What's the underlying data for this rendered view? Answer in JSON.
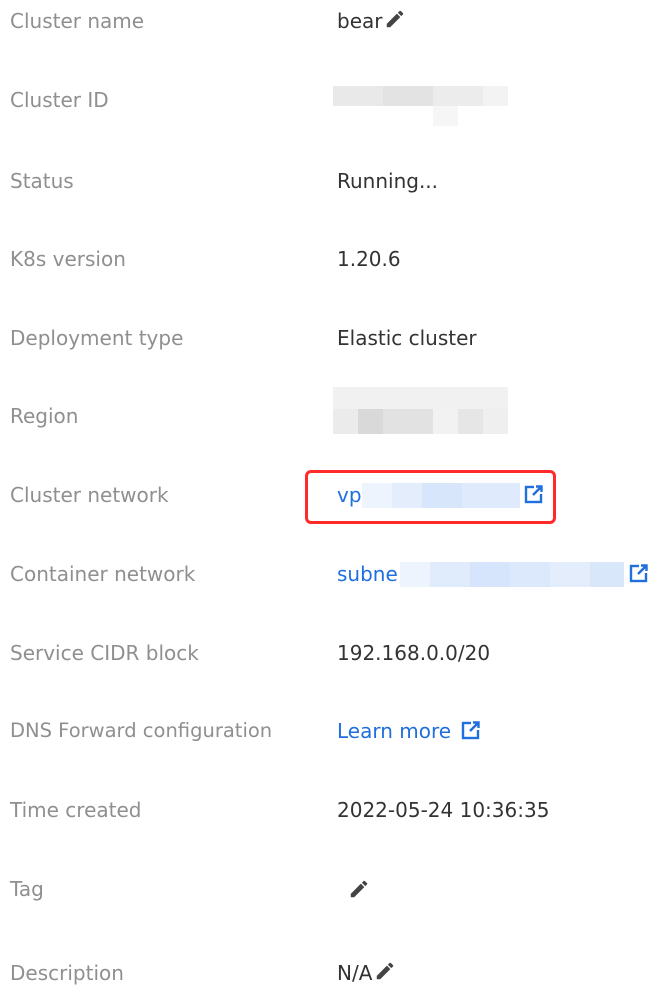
{
  "details": {
    "cluster_name": {
      "label": "Cluster name",
      "value": "bear"
    },
    "cluster_id": {
      "label": "Cluster ID"
    },
    "status": {
      "label": "Status",
      "value": "Running..."
    },
    "k8s_version": {
      "label": "K8s version",
      "value": "1.20.6"
    },
    "deployment_type": {
      "label": "Deployment type",
      "value": "Elastic cluster"
    },
    "region": {
      "label": "Region"
    },
    "cluster_network": {
      "label": "Cluster network",
      "value": "vp"
    },
    "container_network": {
      "label": "Container network",
      "value": "subne"
    },
    "service_cidr": {
      "label": "Service CIDR block",
      "value": "192.168.0.0/20"
    },
    "dns_forward": {
      "label": "DNS Forward configuration",
      "value": "Learn more"
    },
    "time_created": {
      "label": "Time created",
      "value": "2022-05-24 10:36:35"
    },
    "tag": {
      "label": "Tag"
    },
    "description": {
      "label": "Description",
      "value": "N/A"
    }
  },
  "colors": {
    "label": "#8f8f8f",
    "value": "#333333",
    "link": "#1f6fde",
    "highlight": "#ff2a2a",
    "redaction_light": "#eeeeee",
    "redaction_blue": "#dbe8fb"
  },
  "icons": {
    "edit": "pencil-icon",
    "external": "external-link-icon"
  }
}
